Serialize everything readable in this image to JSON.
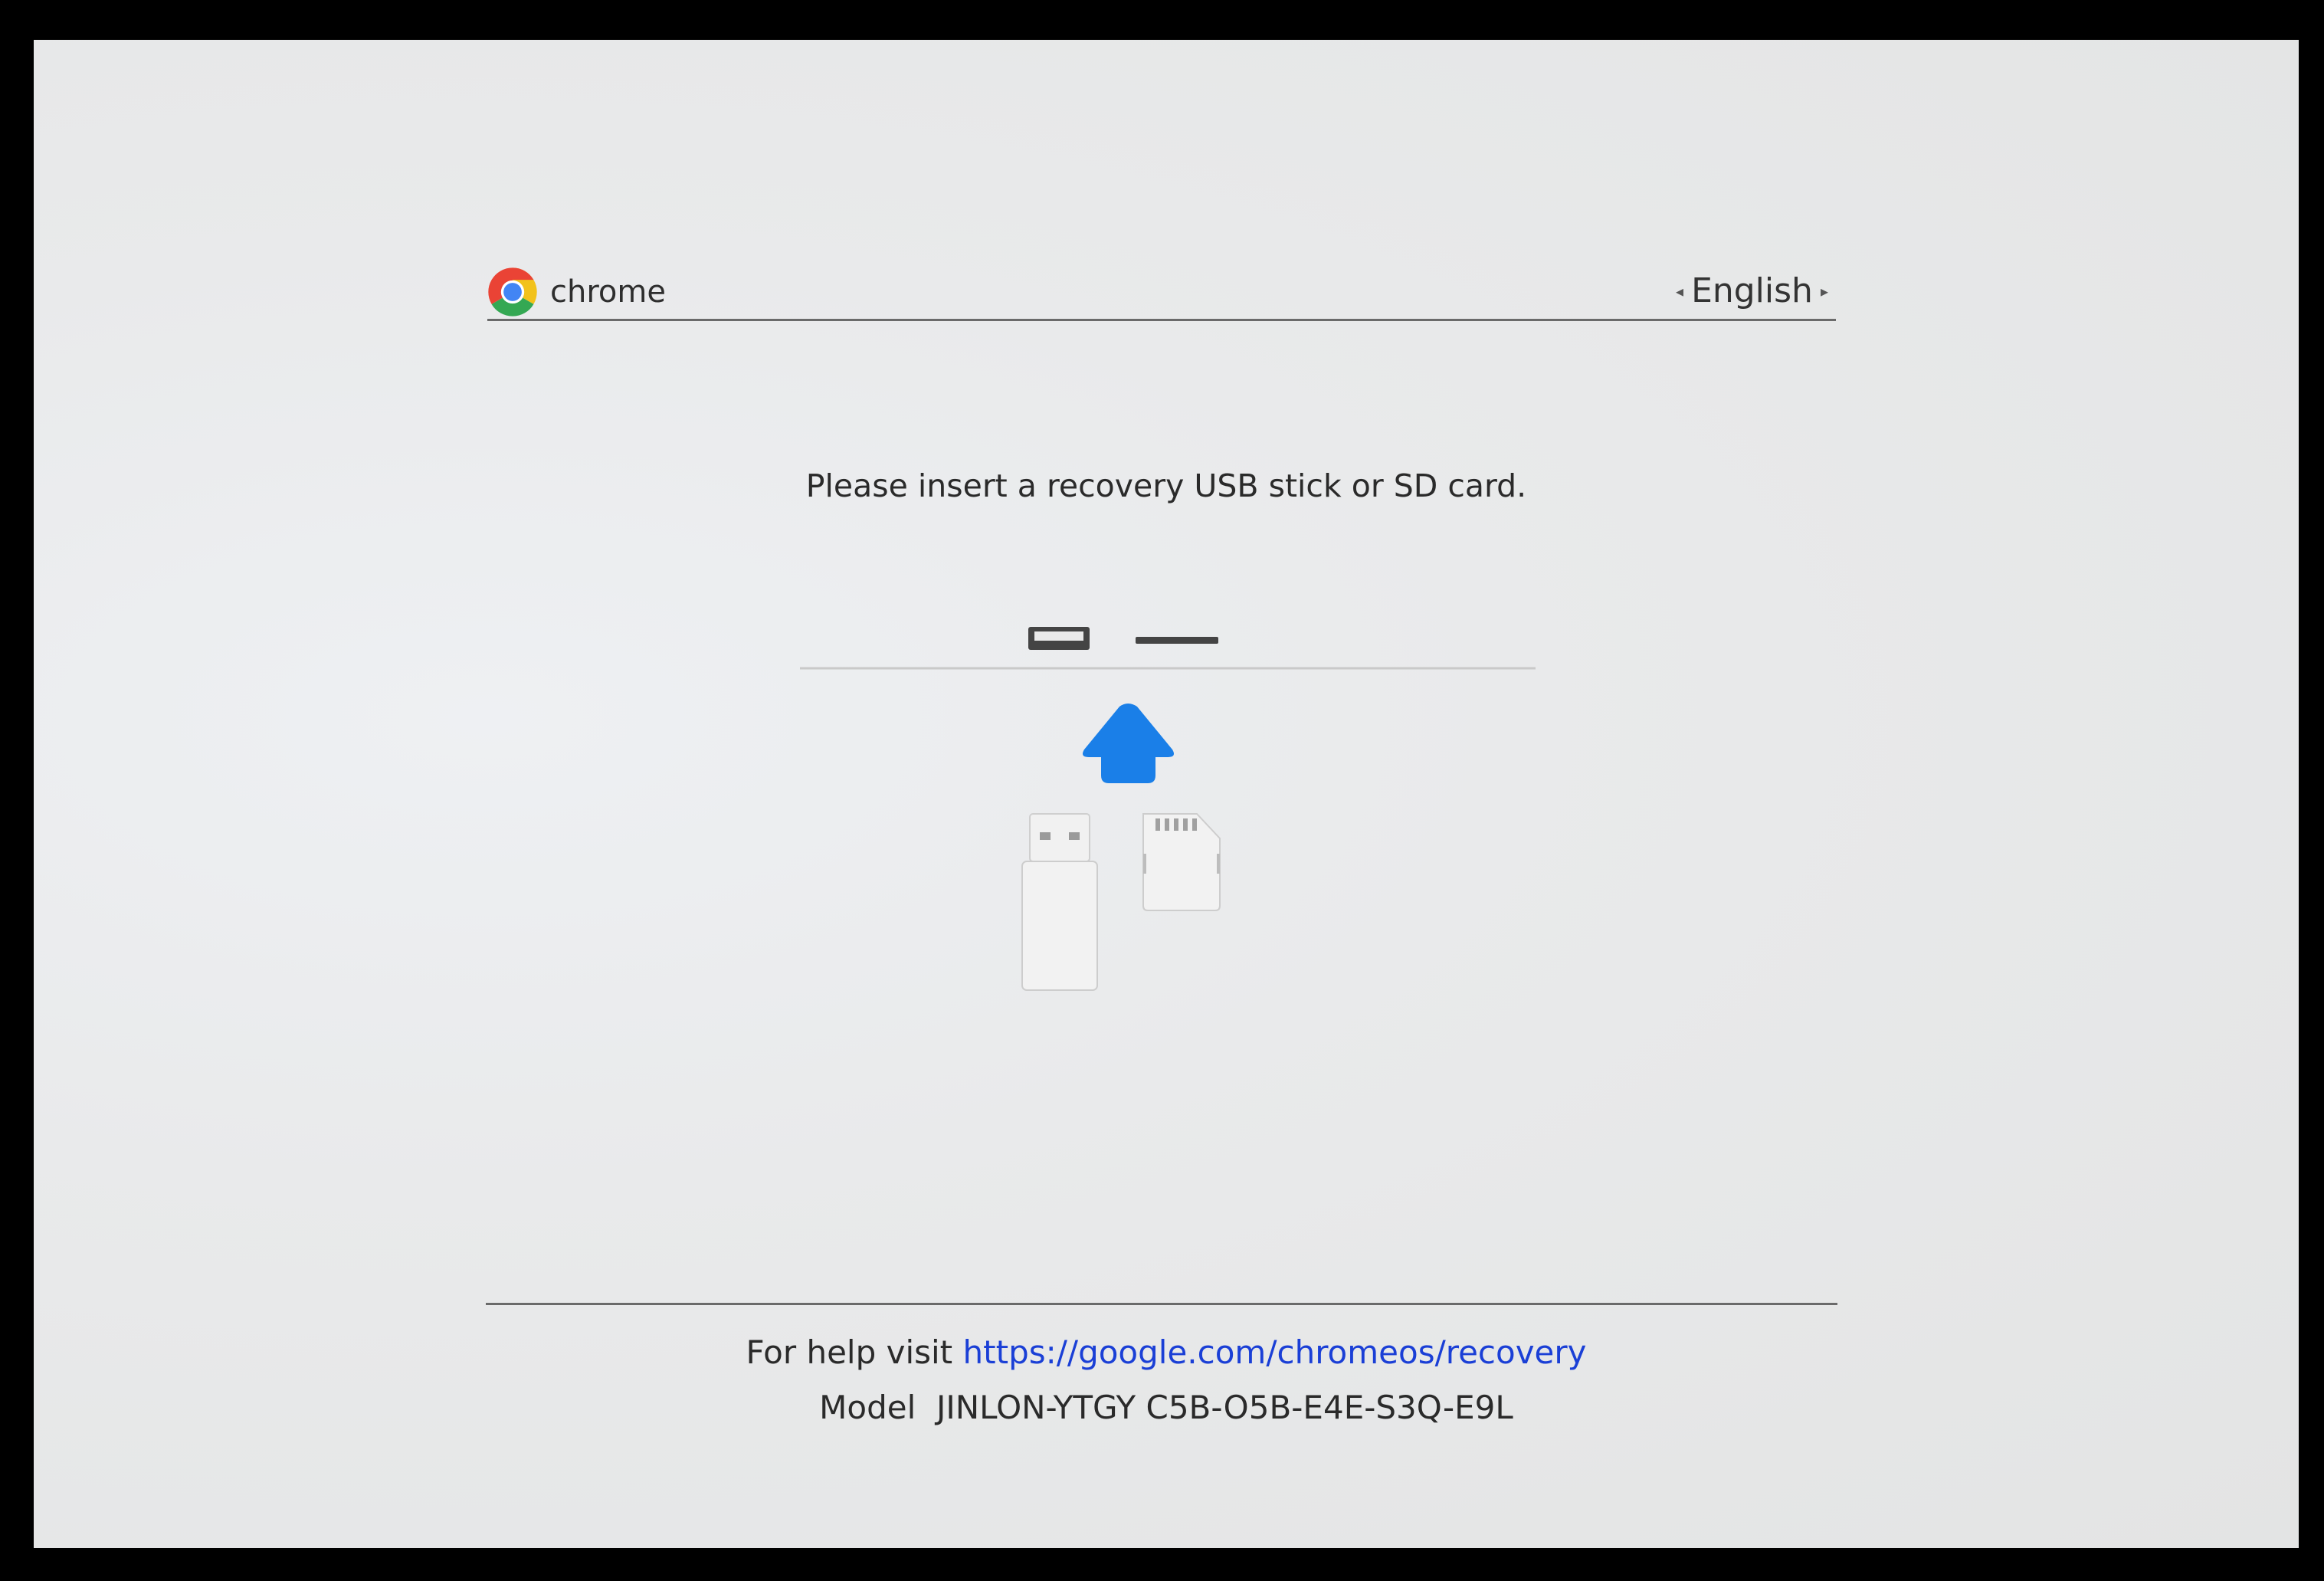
{
  "header": {
    "brand": "chrome",
    "language": "English",
    "prev_arrow": "◂",
    "next_arrow": "▸"
  },
  "message": "Please insert a recovery USB stick or SD card.",
  "footer": {
    "help_prefix": "For help visit",
    "help_link": "https://google.com/chromeos/recovery",
    "model_label": "Model",
    "model_value": "JINLON-YTGY C5B-O5B-E4E-S3Q-E9L"
  },
  "icons": [
    "chrome-logo-icon",
    "usb-port-icon",
    "sd-slot-icon",
    "up-arrow-icon",
    "usb-stick-icon",
    "sd-card-icon"
  ],
  "colors": {
    "arrow": "#1a7fe8",
    "link": "#1a3fd6",
    "background": "#e6e7e8"
  }
}
